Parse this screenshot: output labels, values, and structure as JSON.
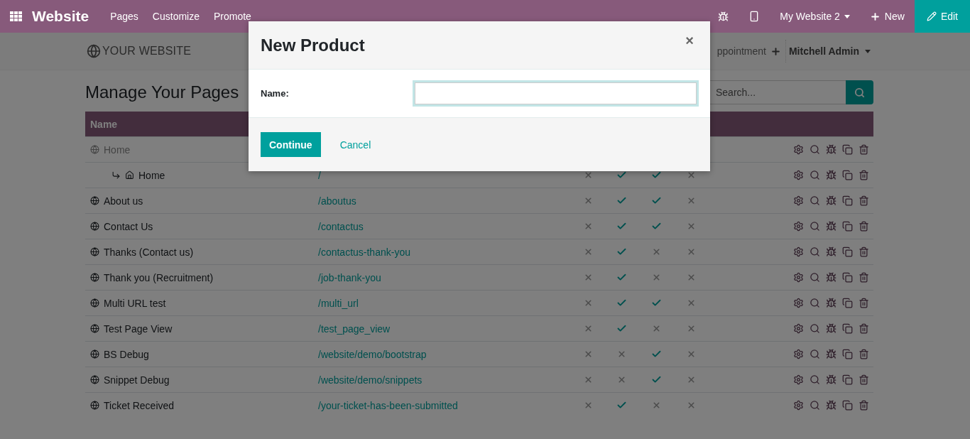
{
  "navbar": {
    "app_title": "Website",
    "menu": [
      "Pages",
      "Customize",
      "Promote"
    ],
    "website_selector": "My Website 2",
    "new_button": "New",
    "edit_button": "Edit"
  },
  "site_header": {
    "logo_text": "YOUR WEBSITE",
    "menu_item": "ppointment",
    "user_menu": "Mitchell Admin"
  },
  "page": {
    "title": "Manage Your Pages",
    "search": {
      "placeholder": "Search..."
    },
    "table": {
      "columns": [
        "Name"
      ],
      "rows": [
        {
          "name": "Home",
          "published": false,
          "children": [
            {
              "name": "Home",
              "url": "/",
              "published": true,
              "checks": [
                false,
                true,
                true,
                false
              ]
            }
          ]
        },
        {
          "name": "About us",
          "url": "/aboutus",
          "published": true,
          "checks": [
            false,
            true,
            true,
            false
          ]
        },
        {
          "name": "Contact Us",
          "url": "/contactus",
          "published": true,
          "checks": [
            false,
            true,
            true,
            false
          ]
        },
        {
          "name": "Thanks (Contact us)",
          "url": "/contactus-thank-you",
          "published": true,
          "checks": [
            false,
            true,
            false,
            false
          ]
        },
        {
          "name": "Thank you (Recruitment)",
          "url": "/job-thank-you",
          "published": true,
          "checks": [
            false,
            true,
            false,
            false
          ]
        },
        {
          "name": "Multi URL test",
          "url": "/multi_url",
          "published": true,
          "checks": [
            false,
            true,
            true,
            false
          ]
        },
        {
          "name": "Test Page View",
          "url": "/test_page_view",
          "published": true,
          "checks": [
            false,
            true,
            false,
            false
          ]
        },
        {
          "name": "BS Debug",
          "url": "/website/demo/bootstrap",
          "published": true,
          "checks": [
            false,
            false,
            true,
            false
          ]
        },
        {
          "name": "Snippet Debug",
          "url": "/website/demo/snippets",
          "published": true,
          "checks": [
            false,
            false,
            true,
            false
          ]
        },
        {
          "name": "Ticket Received",
          "url": "/your-ticket-has-been-submitted",
          "published": true,
          "checks": [
            false,
            true,
            false,
            false
          ]
        }
      ]
    }
  },
  "dialog": {
    "title": "New Product",
    "close": "×",
    "field_label": "Name:",
    "buttons": [
      {
        "label": "Continue",
        "kind": "primary"
      },
      {
        "label": "Cancel",
        "kind": "link"
      }
    ]
  }
}
